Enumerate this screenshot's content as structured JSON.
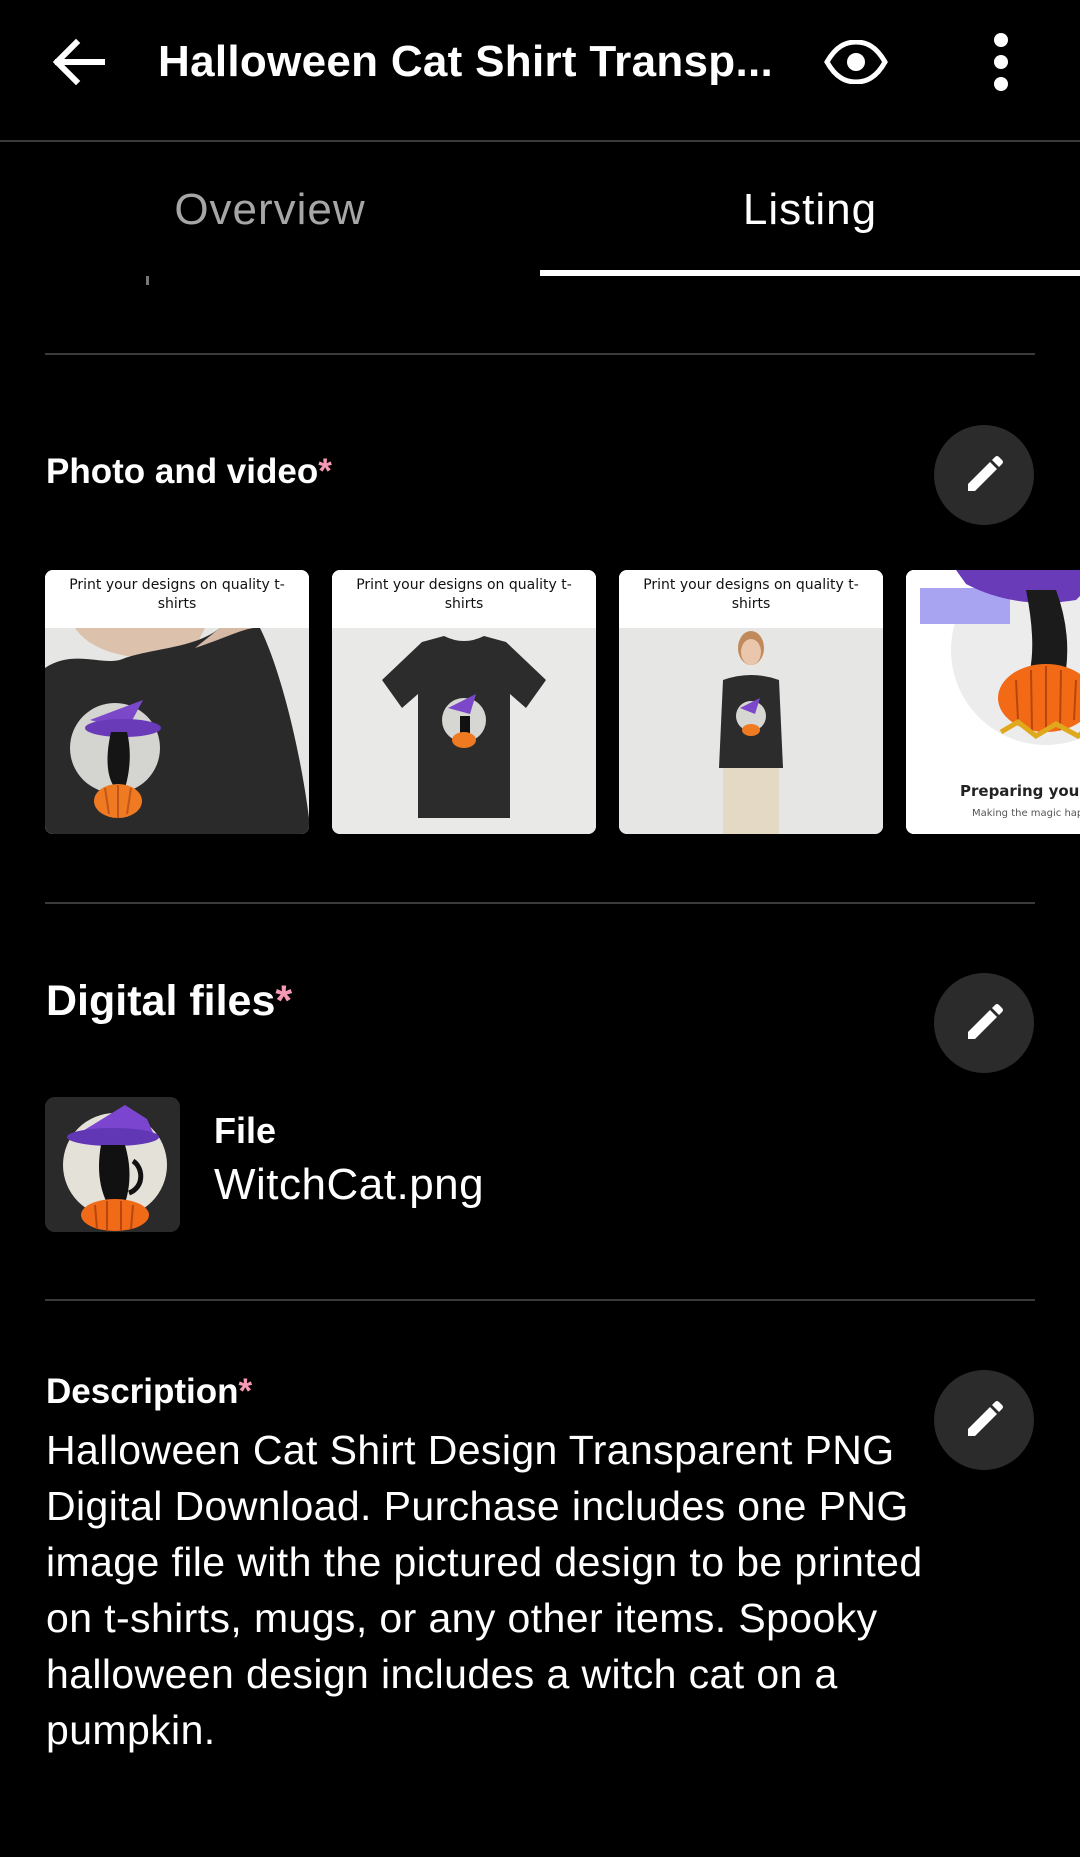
{
  "appbar": {
    "title": "Halloween Cat Shirt Transp...",
    "back_icon": "arrow-left-icon",
    "preview_icon": "eye-icon",
    "more_icon": "more-vertical-icon"
  },
  "tabs": [
    {
      "label": "Overview",
      "selected": false
    },
    {
      "label": "Listing",
      "selected": true
    }
  ],
  "photo_section": {
    "label": "Photo and video",
    "required_mark": "*",
    "photos": [
      {
        "caption": "Print your designs on quality t-shirts"
      },
      {
        "caption": "Print your designs on quality t-shirts"
      },
      {
        "caption": "Print your designs on quality t-shirts"
      },
      {
        "caption_title": "Preparing your de",
        "caption_sub": "Making the magic happ"
      }
    ]
  },
  "digital_files": {
    "label": "Digital files",
    "required_mark": "*",
    "file_label": "File",
    "file_name": "WitchCat.png"
  },
  "description": {
    "label": "Description",
    "required_mark": "*",
    "text": "Halloween Cat Shirt Design Transparent PNG Digital Download. Purchase includes one PNG image file with the pictured design to be printed on t-shirts, mugs, or any other items. Spooky halloween design includes a witch cat on a pumpkin."
  },
  "colors": {
    "background": "#000000",
    "required": "#f49ab4",
    "edit_button_bg": "#2b2b2b",
    "divider": "#3a3a3a"
  }
}
